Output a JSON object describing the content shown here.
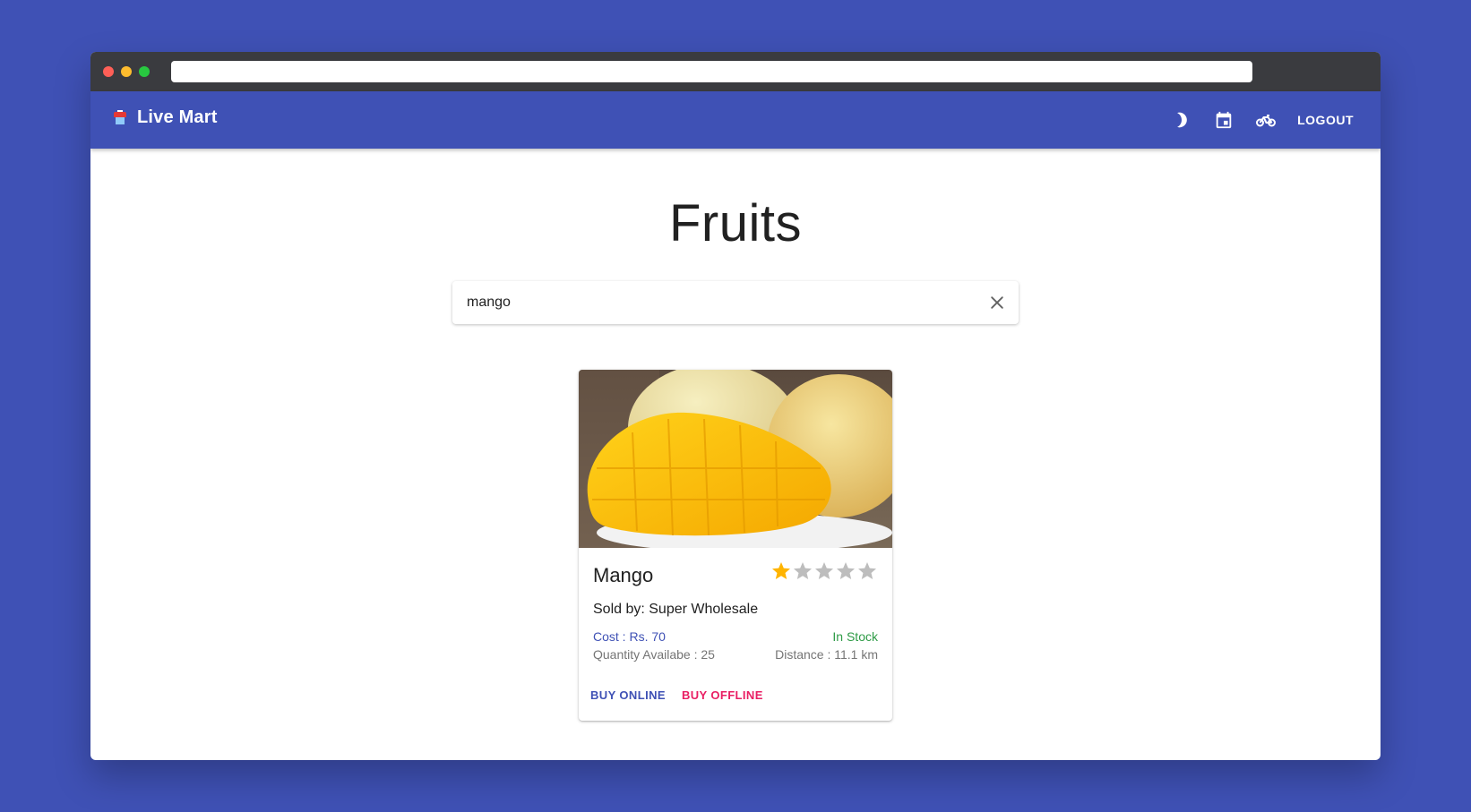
{
  "browser": {
    "url": ""
  },
  "appbar": {
    "title": "Live Mart",
    "logout_label": "LOGOUT",
    "icons": [
      "dark-mode-moon-icon",
      "calendar-icon",
      "bike-delivery-icon"
    ]
  },
  "page": {
    "title": "Fruits"
  },
  "search": {
    "value": "mango",
    "placeholder": ""
  },
  "products": [
    {
      "name": "Mango",
      "rating": 1,
      "rating_max": 5,
      "seller": "Sold by: Super Wholesale",
      "cost": "Cost : Rs. 70",
      "quantity": "Quantity Availabe : 25",
      "stock": "In Stock",
      "distance": "Distance : 11.1 km",
      "buy_online_label": "BUY ONLINE",
      "buy_offline_label": "BUY OFFLINE"
    }
  ],
  "colors": {
    "primary": "#3f51b5",
    "secondary": "#e91e63",
    "in_stock": "#2e9b46",
    "star_filled": "#ffb400",
    "star_empty": "#bdbdbd"
  }
}
